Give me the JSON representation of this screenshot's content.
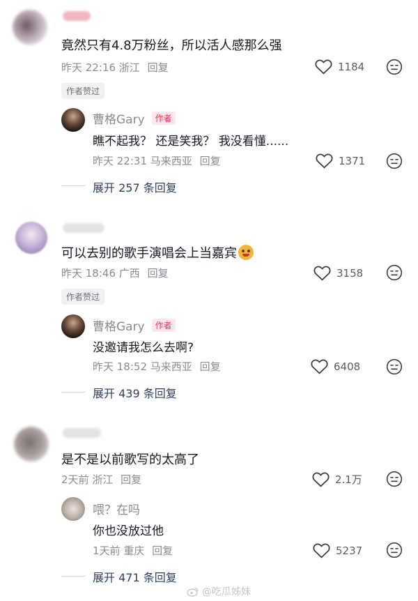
{
  "comments": [
    {
      "text": "竟然只有4.8万粉丝，所以活人感那么强",
      "time": "昨天 22:16",
      "location": "浙江",
      "reply_label": "回复",
      "likes": "1184",
      "author_liked": "作者赞过",
      "reply": {
        "username": "曹格Gary",
        "tag": "作者",
        "text": "瞧不起我？ 还是笑我？ 我没看懂......",
        "time": "昨天 22:31",
        "location": "马来西亚",
        "reply_label": "回复",
        "likes": "1371"
      },
      "expand": "展开 257 条回复"
    },
    {
      "text": "可以去别的歌手演唱会上当嘉宾",
      "time": "昨天 18:46",
      "location": "广西",
      "reply_label": "回复",
      "likes": "3158",
      "author_liked": "作者赞过",
      "reply": {
        "username": "曹格Gary",
        "tag": "作者",
        "text": "没邀请我怎么去啊?",
        "time": "昨天 18:52",
        "location": "马来西亚",
        "reply_label": "回复",
        "likes": "6408"
      },
      "expand": "展开 439 条回复"
    },
    {
      "text": "是不是以前歌写的太高了",
      "time": "2天前",
      "location": "浙江",
      "reply_label": "回复",
      "likes": "2.1万",
      "reply": {
        "username": "喂？在吗",
        "text": "你也没放过他",
        "time": "1天前",
        "location": "重庆",
        "reply_label": "回复",
        "likes": "5237"
      },
      "expand": "展开 471 条回复"
    }
  ],
  "watermark": "@吃瓜姊妹",
  "colors": {
    "author_tag": "#fe2c55",
    "expand_link": "#2d3f61",
    "meta": "#8a8b91"
  }
}
